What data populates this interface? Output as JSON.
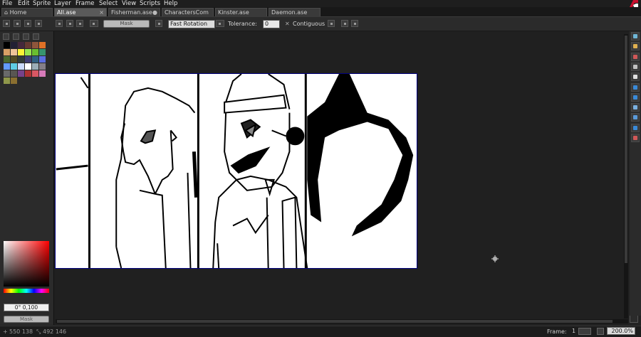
{
  "menubar": {
    "items": [
      "File",
      "Edit",
      "Sprite",
      "Layer",
      "Frame",
      "Select",
      "View",
      "Scripts",
      "Help"
    ]
  },
  "tabs": [
    {
      "label": "Home",
      "icon": "home-icon",
      "active": false
    },
    {
      "label": "All.ase",
      "active": true
    },
    {
      "label": "Fisherman.ase",
      "active": false
    },
    {
      "label": "CharactersCom",
      "active": false
    },
    {
      "label": "Kinster.ase",
      "active": false
    },
    {
      "label": "Daemon.ase",
      "active": false
    }
  ],
  "toolbar": {
    "mask_label": "Mask",
    "rotation_algorithm": "Fast Rotation",
    "tolerance_label": "Tolerance:",
    "tolerance_value": "0",
    "contiguous_label": "Contiguous"
  },
  "palette": {
    "colors": [
      "#000000",
      "#222034",
      "#45283c",
      "#663931",
      "#8f563b",
      "#df7126",
      "#d9a066",
      "#eec39a",
      "#fbf236",
      "#99e550",
      "#6abe30",
      "#37946e",
      "#4b692f",
      "#524b24",
      "#323c39",
      "#3f3f74",
      "#306082",
      "#5b6ee1",
      "#639bff",
      "#5fcde4",
      "#cbdbfc",
      "#ffffff",
      "#9badb7",
      "#847e87",
      "#696a6a",
      "#595652",
      "#76428a",
      "#ac3232",
      "#d95763",
      "#d77bba",
      "#8f974a",
      "#8a6f30"
    ]
  },
  "color_picker": {
    "value_label": "0° 0,100",
    "mask_label": "Mask"
  },
  "status": {
    "position": "550 138",
    "size": "492 146",
    "frame_label": "Frame:",
    "frame_value": "1",
    "zoom": "200.0%"
  },
  "right_tools": [
    "sprite-icon",
    "pencil-icon",
    "eraser-icon",
    "eyedropper-icon",
    "zoom-icon",
    "move-icon",
    "paint-bucket-icon",
    "line-icon",
    "rectangle-icon",
    "lasso-icon",
    "blur-icon"
  ],
  "colors": {
    "accent": "#c8102e",
    "canvas_border": "#000080"
  }
}
